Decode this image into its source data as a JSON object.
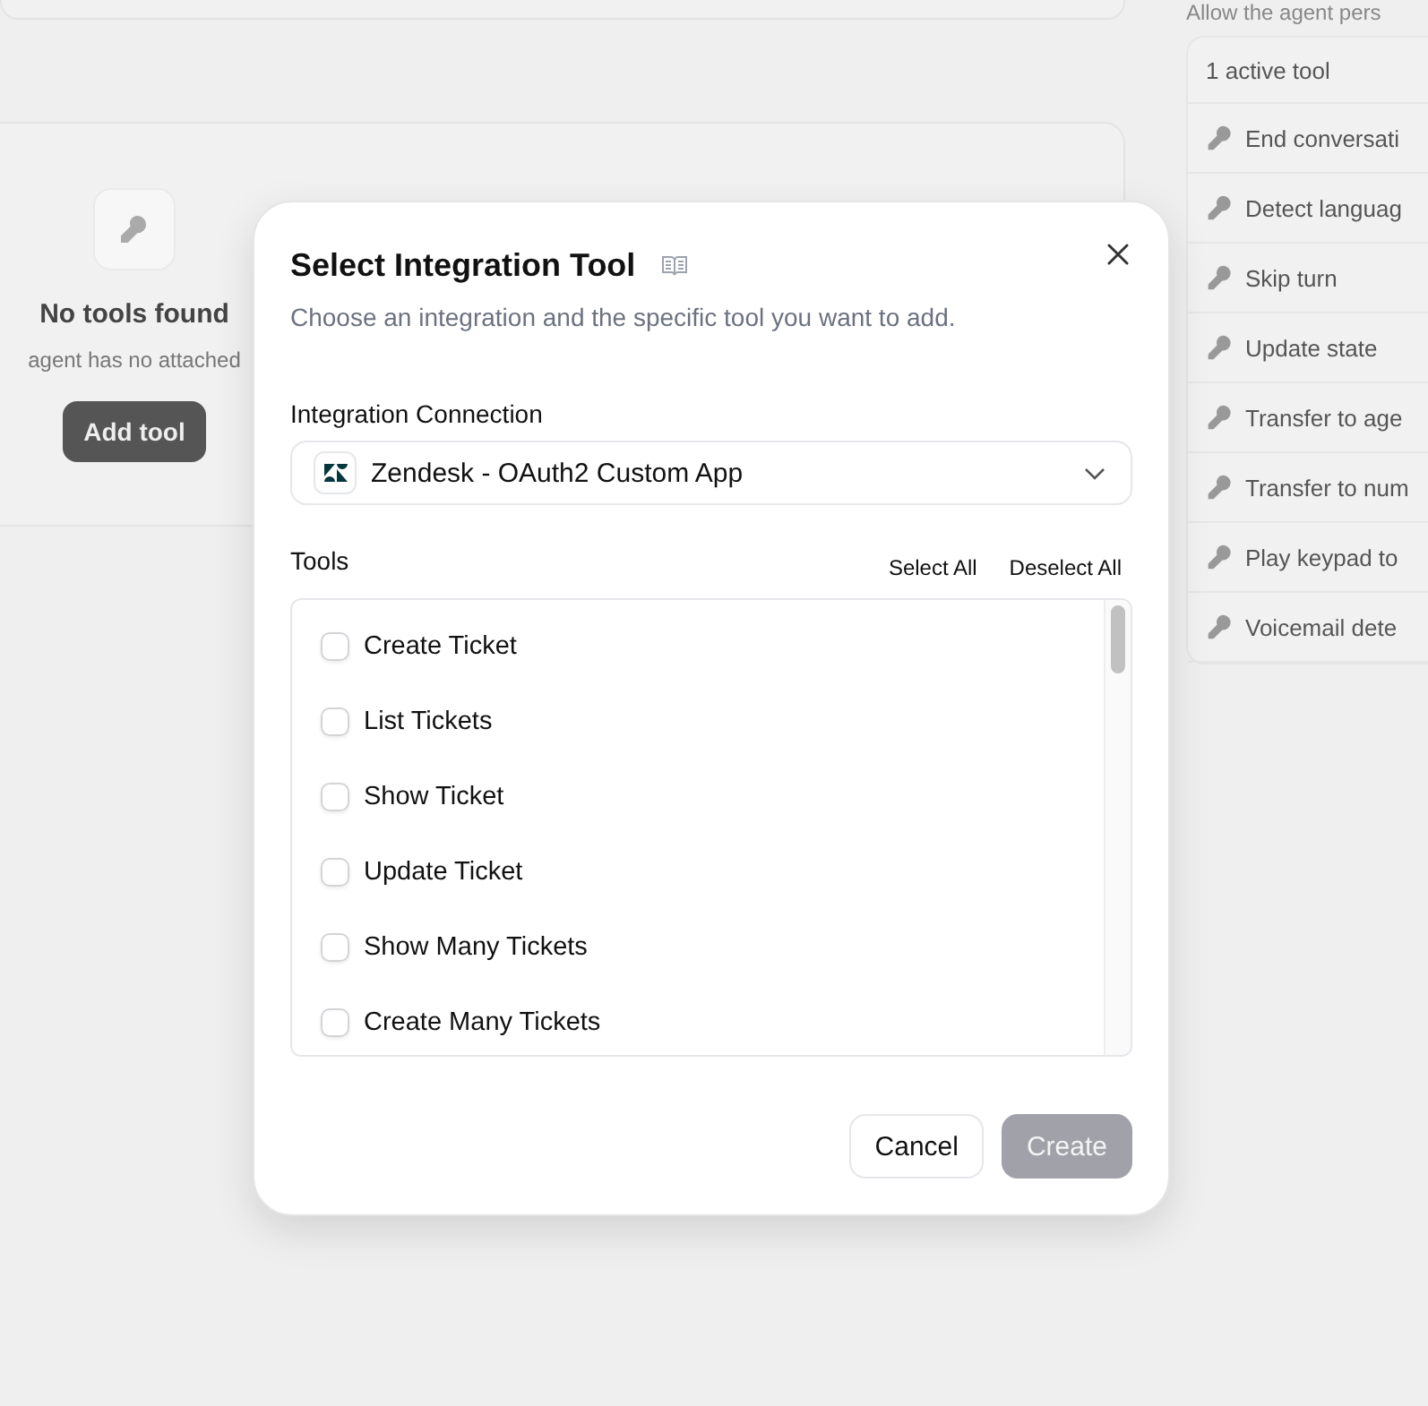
{
  "background": {
    "top_hint": "Allow the agent pers",
    "empty_state": {
      "title": "No tools found",
      "message": "agent has no attached",
      "button": "Add tool"
    },
    "tools_panel": {
      "header": "1 active tool",
      "items": [
        {
          "label": "End conversati"
        },
        {
          "label": "Detect languag"
        },
        {
          "label": "Skip turn"
        },
        {
          "label": "Update state"
        },
        {
          "label": "Transfer to age"
        },
        {
          "label": "Transfer to num"
        },
        {
          "label": "Play keypad to"
        },
        {
          "label": "Voicemail dete"
        }
      ]
    }
  },
  "dialog": {
    "title": "Select Integration Tool",
    "subtitle": "Choose an integration and the specific tool you want to add.",
    "connection_label": "Integration Connection",
    "connection": {
      "value": "Zendesk - OAuth2 Custom App"
    },
    "tools_label": "Tools",
    "select_all": "Select All",
    "deselect_all": "Deselect All",
    "tools": [
      {
        "label": "Create Ticket",
        "checked": false
      },
      {
        "label": "List Tickets",
        "checked": false
      },
      {
        "label": "Show Ticket",
        "checked": false
      },
      {
        "label": "Update Ticket",
        "checked": false
      },
      {
        "label": "Show Many Tickets",
        "checked": false
      },
      {
        "label": "Create Many Tickets",
        "checked": false
      }
    ],
    "buttons": [
      {
        "label": "Cancel",
        "kind": "secondary",
        "disabled": false
      },
      {
        "label": "Create",
        "kind": "primary",
        "disabled": true
      }
    ]
  }
}
